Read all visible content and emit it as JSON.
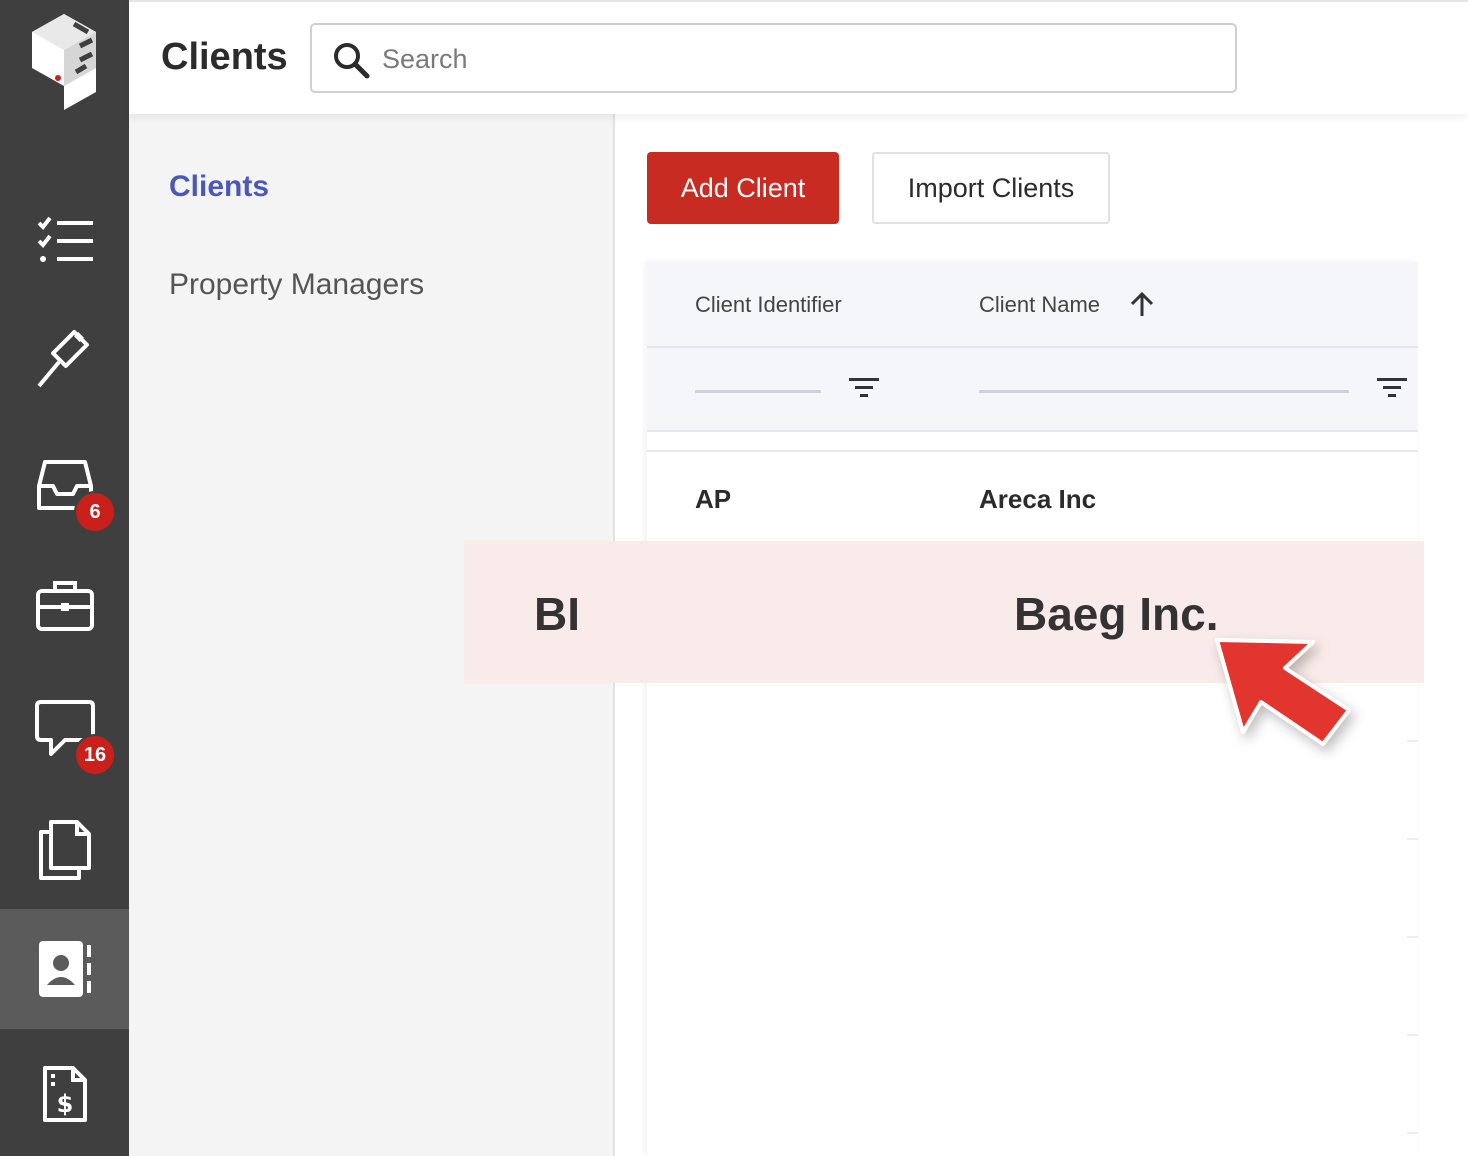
{
  "header": {
    "title": "Clients",
    "search_placeholder": "Search"
  },
  "rail": {
    "items": [
      {
        "icon": "checklist-icon"
      },
      {
        "icon": "gavel-icon"
      },
      {
        "icon": "inbox-icon",
        "badge": "6"
      },
      {
        "icon": "briefcase-icon"
      },
      {
        "icon": "chat-icon",
        "badge": "16"
      },
      {
        "icon": "documents-icon"
      },
      {
        "icon": "contacts-icon",
        "active": true
      },
      {
        "icon": "invoice-icon"
      }
    ]
  },
  "subnav": {
    "items": [
      {
        "label": "Clients",
        "active": true
      },
      {
        "label": "Property Managers",
        "active": false
      }
    ]
  },
  "toolbar": {
    "add_label": "Add Client",
    "import_label": "Import Clients"
  },
  "table": {
    "columns": [
      "Client Identifier",
      "Client Name"
    ],
    "sort": {
      "column": "Client Name",
      "direction": "ascending"
    },
    "rows": [
      {
        "id": "AP",
        "name": "Areca Inc"
      }
    ]
  },
  "highlight": {
    "id": "BI",
    "name": "Baeg Inc."
  },
  "colors": {
    "rail_bg": "#3f3f3f",
    "accent": "#c72b22",
    "nav_active": "#4c58b8",
    "badge": "#c9201c",
    "highlight_bg": "#f9ebea"
  }
}
